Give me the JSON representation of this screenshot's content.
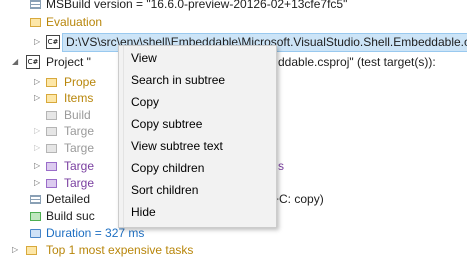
{
  "tree": {
    "msbuild_version": "MSBuild version = \"16.6.0-preview-20126-02+13cfe7fc5\"",
    "evaluation": "Evaluation",
    "evaluation_path": "D:\\VS\\src\\env\\shell\\Embeddable\\Microsoft.VisualStudio.Shell.Embeddable.c",
    "project_left": "Project \"",
    "project_right": "ddable.csproj\" (test target(s)):",
    "properties": "Prope",
    "items": "Items",
    "build_hidden": "Build",
    "target_a": "Targe",
    "target_b": "Targe",
    "target_c": "Targe",
    "target_c_suffix": "s",
    "target_d": "Targe",
    "detailed": "Detailed",
    "detailed_suffix": "+C: copy)",
    "build_succeeded": "Build suc",
    "duration": "Duration = 327 ms",
    "top_tasks": "Top 1 most expensive tasks",
    "csharp_badge": "C#"
  },
  "context_menu": {
    "items": [
      "View",
      "Search in subtree",
      "Copy",
      "Copy subtree",
      "View subtree text",
      "Copy children",
      "Sort children",
      "Hide"
    ]
  },
  "colors": {
    "selection": "#cce4f7",
    "folder": "#fde7a8",
    "target_folder": "#dccbef",
    "menu_background": "#f2f2f2",
    "duration_text": "#1e6fc2"
  }
}
